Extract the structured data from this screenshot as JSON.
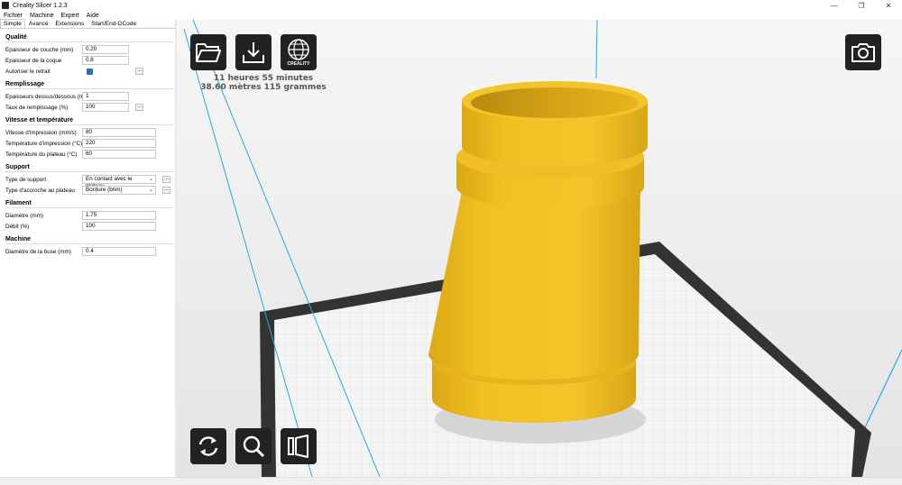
{
  "window": {
    "title": "Creality Slicer 1.2.3",
    "controls": {
      "minimize": "—",
      "maximize": "❐",
      "close": "✕"
    }
  },
  "menu": [
    "Fichier",
    "Machine",
    "Expert",
    "Aide"
  ],
  "tabs": [
    "Simple",
    "Avancé",
    "Extensions",
    "Start/End-GCode"
  ],
  "panel": {
    "qualite": {
      "title": "Qualité",
      "layer_height": {
        "label": "Epaisseur de couche (mm)",
        "value": "0.20"
      },
      "shell": {
        "label": "Epaisseur de la coque",
        "value": "0.8"
      },
      "retract": {
        "label": "Autoriser le retrait",
        "more": "..."
      }
    },
    "remplissage": {
      "title": "Remplissage",
      "top_bottom": {
        "label": "Epaisseurs dessus/dessous (mm)",
        "value": "1"
      },
      "density": {
        "label": "Taux de remplissage (%)",
        "value": "100",
        "more": "..."
      }
    },
    "vitesse": {
      "title": "Vitesse et température",
      "speed": {
        "label": "Vitesse d'impression (mm/s)",
        "value": "80"
      },
      "temp": {
        "label": "Température d'impression (°C)",
        "value": "220"
      },
      "bed": {
        "label": "Température du plateau (°C)",
        "value": "60"
      }
    },
    "support": {
      "title": "Support",
      "type": {
        "label": "Type de support",
        "value": "En contact avec le plateau",
        "more": "..."
      },
      "adhesion": {
        "label": "Type d'accroche au plateau",
        "value": "Bordure (brim)",
        "more": "..."
      }
    },
    "filament": {
      "title": "Filament",
      "diameter": {
        "label": "Diamètre (mm)",
        "value": "1.75"
      },
      "flow": {
        "label": "Débit (%)",
        "value": "100"
      }
    },
    "machine": {
      "title": "Machine",
      "nozzle": {
        "label": "Diamètre de la buse (mm)",
        "value": "0.4"
      }
    }
  },
  "viewport": {
    "print_time": "11 heures 55 minutes",
    "print_material": "38.60 mètres 115 grammes",
    "logo_text": "CREALITY",
    "icons": [
      "folder-open-icon",
      "download-icon",
      "creality-globe-icon",
      "camera-icon",
      "rotate-icon",
      "zoom-icon",
      "view-mode-icon"
    ],
    "colors": {
      "model": "#f2c022",
      "model_shadow": "#c99a12",
      "button": "#222222",
      "bed": "#f4f4f4",
      "bed_frame": "#333333",
      "build_lines": "#29a8e0"
    }
  }
}
